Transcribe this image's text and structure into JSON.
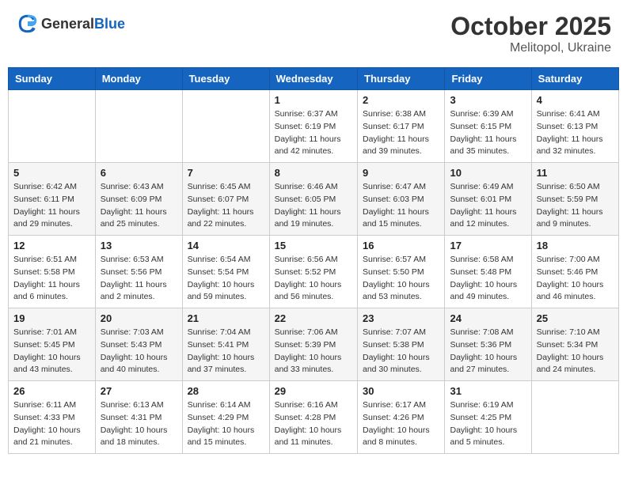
{
  "header": {
    "logo_general": "General",
    "logo_blue": "Blue",
    "month": "October 2025",
    "location": "Melitopol, Ukraine"
  },
  "days_of_week": [
    "Sunday",
    "Monday",
    "Tuesday",
    "Wednesday",
    "Thursday",
    "Friday",
    "Saturday"
  ],
  "weeks": [
    [
      {
        "day": "",
        "info": ""
      },
      {
        "day": "",
        "info": ""
      },
      {
        "day": "",
        "info": ""
      },
      {
        "day": "1",
        "info": "Sunrise: 6:37 AM\nSunset: 6:19 PM\nDaylight: 11 hours\nand 42 minutes."
      },
      {
        "day": "2",
        "info": "Sunrise: 6:38 AM\nSunset: 6:17 PM\nDaylight: 11 hours\nand 39 minutes."
      },
      {
        "day": "3",
        "info": "Sunrise: 6:39 AM\nSunset: 6:15 PM\nDaylight: 11 hours\nand 35 minutes."
      },
      {
        "day": "4",
        "info": "Sunrise: 6:41 AM\nSunset: 6:13 PM\nDaylight: 11 hours\nand 32 minutes."
      }
    ],
    [
      {
        "day": "5",
        "info": "Sunrise: 6:42 AM\nSunset: 6:11 PM\nDaylight: 11 hours\nand 29 minutes."
      },
      {
        "day": "6",
        "info": "Sunrise: 6:43 AM\nSunset: 6:09 PM\nDaylight: 11 hours\nand 25 minutes."
      },
      {
        "day": "7",
        "info": "Sunrise: 6:45 AM\nSunset: 6:07 PM\nDaylight: 11 hours\nand 22 minutes."
      },
      {
        "day": "8",
        "info": "Sunrise: 6:46 AM\nSunset: 6:05 PM\nDaylight: 11 hours\nand 19 minutes."
      },
      {
        "day": "9",
        "info": "Sunrise: 6:47 AM\nSunset: 6:03 PM\nDaylight: 11 hours\nand 15 minutes."
      },
      {
        "day": "10",
        "info": "Sunrise: 6:49 AM\nSunset: 6:01 PM\nDaylight: 11 hours\nand 12 minutes."
      },
      {
        "day": "11",
        "info": "Sunrise: 6:50 AM\nSunset: 5:59 PM\nDaylight: 11 hours\nand 9 minutes."
      }
    ],
    [
      {
        "day": "12",
        "info": "Sunrise: 6:51 AM\nSunset: 5:58 PM\nDaylight: 11 hours\nand 6 minutes."
      },
      {
        "day": "13",
        "info": "Sunrise: 6:53 AM\nSunset: 5:56 PM\nDaylight: 11 hours\nand 2 minutes."
      },
      {
        "day": "14",
        "info": "Sunrise: 6:54 AM\nSunset: 5:54 PM\nDaylight: 10 hours\nand 59 minutes."
      },
      {
        "day": "15",
        "info": "Sunrise: 6:56 AM\nSunset: 5:52 PM\nDaylight: 10 hours\nand 56 minutes."
      },
      {
        "day": "16",
        "info": "Sunrise: 6:57 AM\nSunset: 5:50 PM\nDaylight: 10 hours\nand 53 minutes."
      },
      {
        "day": "17",
        "info": "Sunrise: 6:58 AM\nSunset: 5:48 PM\nDaylight: 10 hours\nand 49 minutes."
      },
      {
        "day": "18",
        "info": "Sunrise: 7:00 AM\nSunset: 5:46 PM\nDaylight: 10 hours\nand 46 minutes."
      }
    ],
    [
      {
        "day": "19",
        "info": "Sunrise: 7:01 AM\nSunset: 5:45 PM\nDaylight: 10 hours\nand 43 minutes."
      },
      {
        "day": "20",
        "info": "Sunrise: 7:03 AM\nSunset: 5:43 PM\nDaylight: 10 hours\nand 40 minutes."
      },
      {
        "day": "21",
        "info": "Sunrise: 7:04 AM\nSunset: 5:41 PM\nDaylight: 10 hours\nand 37 minutes."
      },
      {
        "day": "22",
        "info": "Sunrise: 7:06 AM\nSunset: 5:39 PM\nDaylight: 10 hours\nand 33 minutes."
      },
      {
        "day": "23",
        "info": "Sunrise: 7:07 AM\nSunset: 5:38 PM\nDaylight: 10 hours\nand 30 minutes."
      },
      {
        "day": "24",
        "info": "Sunrise: 7:08 AM\nSunset: 5:36 PM\nDaylight: 10 hours\nand 27 minutes."
      },
      {
        "day": "25",
        "info": "Sunrise: 7:10 AM\nSunset: 5:34 PM\nDaylight: 10 hours\nand 24 minutes."
      }
    ],
    [
      {
        "day": "26",
        "info": "Sunrise: 6:11 AM\nSunset: 4:33 PM\nDaylight: 10 hours\nand 21 minutes."
      },
      {
        "day": "27",
        "info": "Sunrise: 6:13 AM\nSunset: 4:31 PM\nDaylight: 10 hours\nand 18 minutes."
      },
      {
        "day": "28",
        "info": "Sunrise: 6:14 AM\nSunset: 4:29 PM\nDaylight: 10 hours\nand 15 minutes."
      },
      {
        "day": "29",
        "info": "Sunrise: 6:16 AM\nSunset: 4:28 PM\nDaylight: 10 hours\nand 11 minutes."
      },
      {
        "day": "30",
        "info": "Sunrise: 6:17 AM\nSunset: 4:26 PM\nDaylight: 10 hours\nand 8 minutes."
      },
      {
        "day": "31",
        "info": "Sunrise: 6:19 AM\nSunset: 4:25 PM\nDaylight: 10 hours\nand 5 minutes."
      },
      {
        "day": "",
        "info": ""
      }
    ]
  ]
}
